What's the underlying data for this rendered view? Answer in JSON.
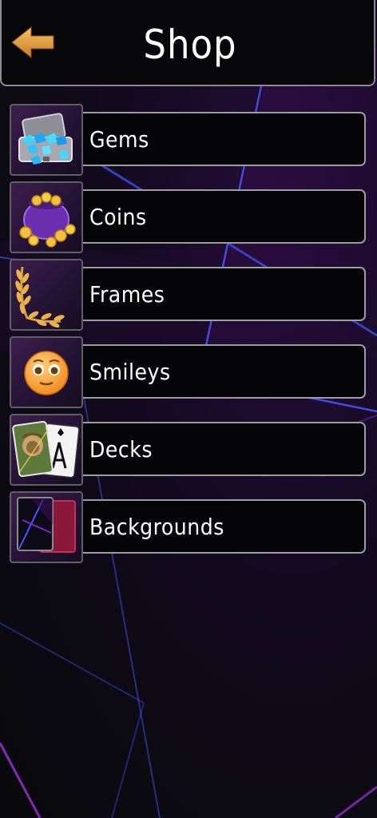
{
  "header": {
    "title": "Shop",
    "back_icon": "back-arrow-icon",
    "back_color": "#e8a33a"
  },
  "menu": {
    "items": [
      {
        "label": "Gems",
        "icon": "gems-case-icon"
      },
      {
        "label": "Coins",
        "icon": "coins-pot-icon"
      },
      {
        "label": "Frames",
        "icon": "laurel-frame-icon"
      },
      {
        "label": "Smileys",
        "icon": "smiley-face-icon"
      },
      {
        "label": "Decks",
        "icon": "playing-cards-icon"
      },
      {
        "label": "Backgrounds",
        "icon": "backgrounds-icon"
      }
    ]
  },
  "theme": {
    "accent": "#e8a33a",
    "bar_border": "#9c9ca3",
    "neon_blue": "#3f4de0",
    "neon_purple": "#8a2fd0"
  }
}
